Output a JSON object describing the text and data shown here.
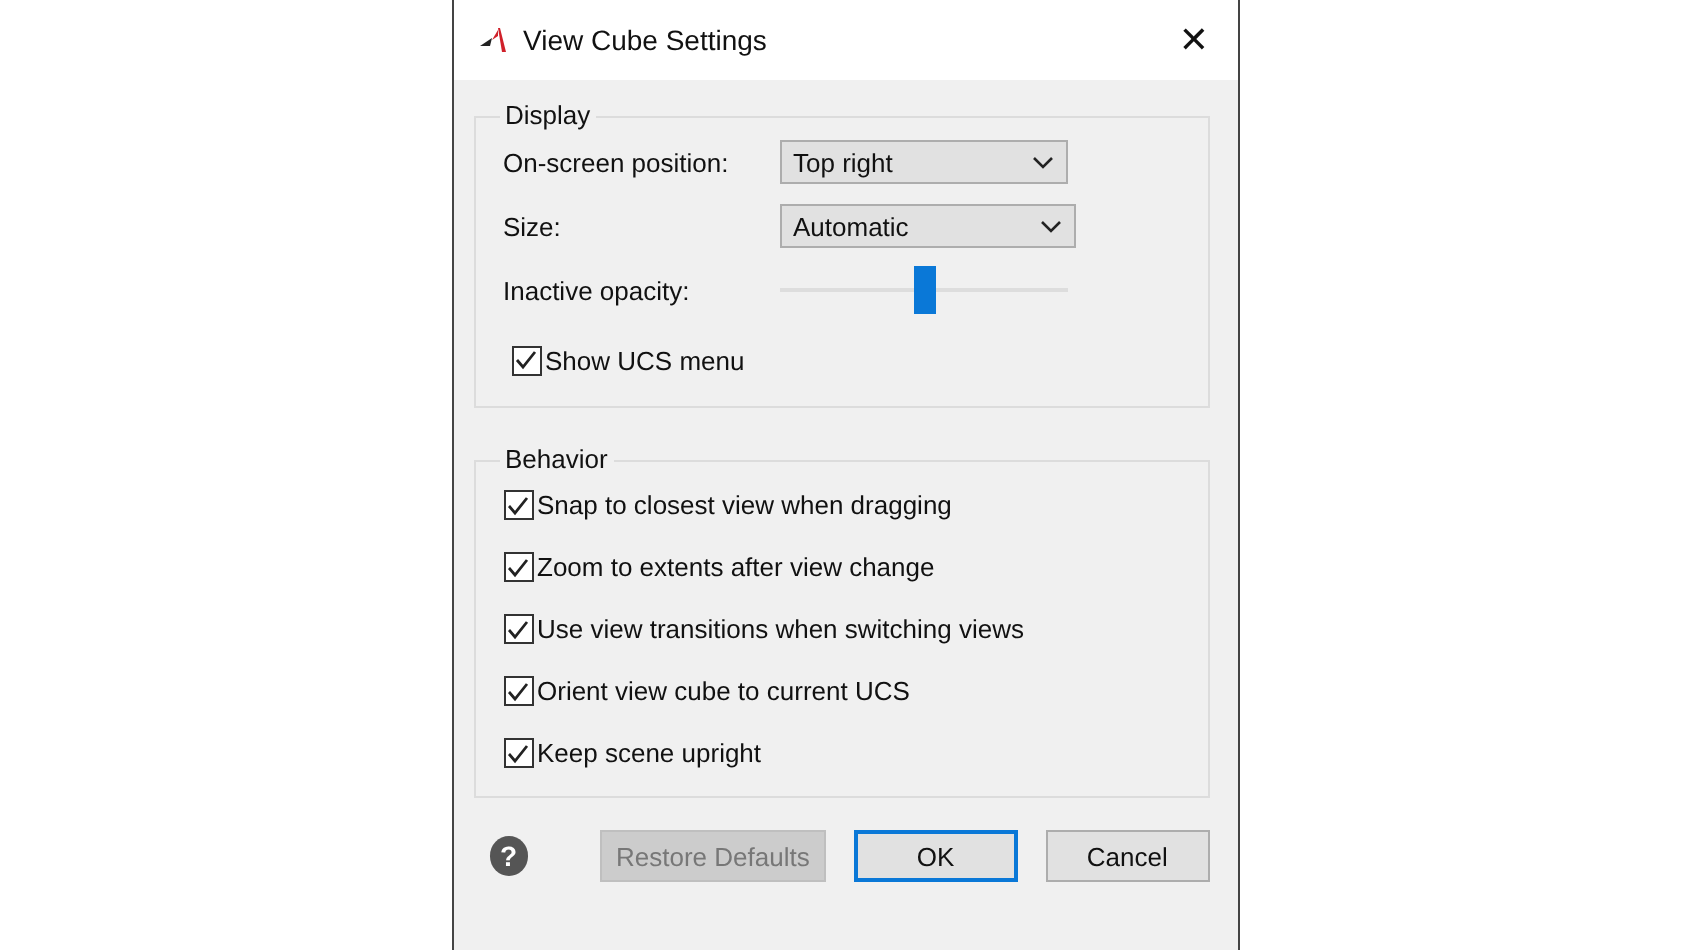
{
  "window": {
    "title": "View Cube Settings",
    "close": "✕"
  },
  "display": {
    "title": "Display",
    "fields": [
      {
        "label": "On-screen position:",
        "value": "Top right"
      },
      {
        "label": "Size:",
        "value": "Automatic"
      }
    ],
    "opacity": {
      "label": "Inactive opacity:",
      "level": 0.5
    },
    "show_ucs_menu": {
      "label": "Show UCS menu",
      "checked": true
    }
  },
  "behavior": {
    "title": "Behavior",
    "options": [
      {
        "label": "Snap to closest view when dragging",
        "checked": true
      },
      {
        "label": "Zoom to extents after view change",
        "checked": true
      },
      {
        "label": "Use view transitions when switching views",
        "checked": true
      },
      {
        "label": "Orient view cube to current UCS",
        "checked": true
      },
      {
        "label": "Keep scene upright",
        "checked": true
      }
    ]
  },
  "help": "?",
  "buttons": [
    {
      "label": "Restore Defaults",
      "disabled": true,
      "default": false
    },
    {
      "label": "OK",
      "disabled": false,
      "default": true
    },
    {
      "label": "Cancel",
      "disabled": false,
      "default": false
    }
  ]
}
